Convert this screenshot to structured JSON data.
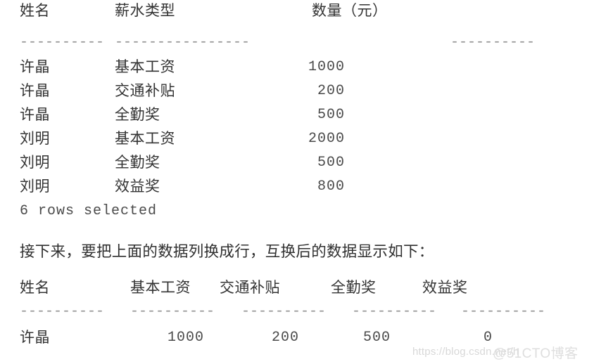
{
  "page": {
    "background": "#ffffff",
    "text_color": "#333333",
    "rule_color": "#8d8d8d"
  },
  "table_one": {
    "name": "salary-long-format-result",
    "headers": [
      "姓名",
      "薪水类型",
      "数量（元）"
    ],
    "rule": [
      "----------",
      "----------------",
      "----------"
    ],
    "rows": [
      {
        "name": "许晶",
        "type": "基本工资",
        "amount": "1000"
      },
      {
        "name": "许晶",
        "type": "交通补贴",
        "amount": "200"
      },
      {
        "name": "许晶",
        "type": "全勤奖",
        "amount": "500"
      },
      {
        "name": "刘明",
        "type": "基本工资",
        "amount": "2000"
      },
      {
        "name": "刘明",
        "type": "全勤奖",
        "amount": "500"
      },
      {
        "name": "刘明",
        "type": "效益奖",
        "amount": "800"
      }
    ],
    "status": "6 rows selected"
  },
  "note": {
    "text": "接下来，要把上面的数据列换成行，互换后的数据显示如下："
  },
  "table_two": {
    "name": "salary-pivot-result",
    "headers": [
      "姓名",
      "基本工资",
      "交通补贴",
      "全勤奖",
      "效益奖"
    ],
    "rule": [
      "----------",
      "----------",
      "----------",
      "----------",
      "----------"
    ],
    "rows": [
      {
        "name": "许晶",
        "base": "1000",
        "transport": "200",
        "attendance": "500",
        "bonus": "0"
      }
    ]
  },
  "watermarks": {
    "csdn": "https://blog.csdn.net/h",
    "cto": "@51CTO博客"
  }
}
